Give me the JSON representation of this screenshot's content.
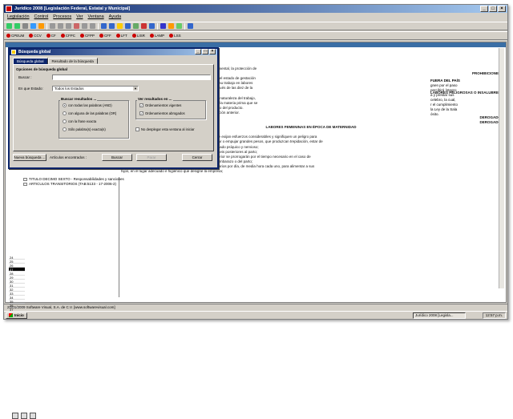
{
  "window": {
    "title": "Jurídico 2008 [Legislación Federal, Estatal y Municipal]",
    "btn_min": "_",
    "btn_max": "□",
    "btn_close": "×"
  },
  "menu": [
    "Legislación",
    "Control",
    "Procesos",
    "Ver",
    "Ventana",
    "Ayuda"
  ],
  "codes": [
    "CPEUM",
    "CCV",
    "CF",
    "CFPC",
    "CFPP",
    "CFF",
    "LFT",
    "LISR",
    "LAMP",
    "LSS"
  ],
  "dialog": {
    "title": "Búsqueda global",
    "tabs": [
      "Búsqueda global",
      "Resultado de la búsqueda"
    ],
    "options_title": "Opciones de búsqueda global",
    "buscar_label": "Buscar :",
    "buscar_value": "",
    "estado_label": "En que Estado:",
    "estado_value": "Todos los Estados",
    "buscar_resultados_title": "Buscar resultados ...",
    "radios": [
      "con todas las palabras (AND)",
      "con alguna de las palabras (OR)",
      "con la frase exacta",
      "Sólo palabra(s) exacta(s)"
    ],
    "ver_title": "Ver resultados en ...",
    "ver_checks": [
      "Ordenamientos vigentes",
      "Ordenamientos abrogados"
    ],
    "no_display": "No desplegar esta ventana al iniciar",
    "btn_nueva": "Nueva búsqueda ...",
    "found_label": "Artículos encontrados :",
    "btn_buscar": "Buscar",
    "btn_parar": "Parar",
    "btn_cerrar": "Cerrar"
  },
  "tree": [
    "TITULO DECIMO SEXTO - Responsabilidades y sanciones",
    "ARTICULOS TRANSITORIOS (TAB:5133 - 17-2006-2)"
  ],
  "numbers": [
    "24",
    "25",
    "26",
    "27",
    "28",
    "29",
    "30",
    "31",
    "32",
    "33",
    "34",
    "35",
    "36",
    "37"
  ],
  "doc_lines": [
    {
      "t": "e se consignan en este capítulo tienen como propósito fundamental, la protección de",
      "c": ""
    },
    {
      "t": "PROHIBICIONES",
      "c": "hr"
    },
    {
      "t": "peligro la salud de la mujer, o la del producto, ya sea durante el estado de gestación",
      "c": ""
    },
    {
      "t": "o en su salario, prestaciones y derechos, no se podrá utilizar su trabajo en labores",
      "c": ""
    },
    {
      "t": "industrial, en establecimientos comerciales o de servicio después de las diez de la",
      "c": ""
    },
    {
      "t": "",
      "c": ""
    },
    {
      "t": "LABORES PELIGROSAS O INSALUBRES",
      "c": "hr"
    },
    {
      "t": "este título, son labores peligrosas o insalubres las que, por la naturaleza del trabajo,",
      "c": ""
    },
    {
      "t": "ológicas del medio en que se presta, o por la composición de la materia prima que se",
      "c": ""
    },
    {
      "t": "y la salud física y mental de la mujer en estado de gestación, o del producto.",
      "c": ""
    },
    {
      "t": "erminarán los trabajos que quedan comprendidos en la definición anterior.",
      "c": ""
    },
    {
      "t": "",
      "c": ""
    },
    {
      "t": "DEROGADO",
      "c": "hr"
    },
    {
      "t": "",
      "c": ""
    },
    {
      "t": "DEROGADO",
      "c": "hr"
    },
    {
      "t": "",
      "c": ""
    },
    {
      "t": "LABORES FEMENINAS EN ÉPOCA DE MATERNIDAD",
      "c": "h"
    },
    {
      "t": "Las madres trabajadoras tendrán los siguientes derechos:",
      "c": ""
    },
    {
      "t": "I. Durante el período del embarazo, no realizarán trabajos que exijan esfuerzos considerables y signifiquen un peligro para",
      "c": ""
    },
    {
      "t": "su salud en relación con la gestación, tales como levantar, tirar o empujar grandes pesos, que produzcan trepidación, estar de",
      "c": ""
    },
    {
      "t": "pie durante largo tiempo o que actúen o puedan alterar su estado psíquico y nervioso;",
      "c": ""
    },
    {
      "t": "II. Disfrutarán de un descanso de seis semanas anteriores y seis posteriores al parto;",
      "c": ""
    },
    {
      "t": "III. Los períodos de descanso a que se refiere la fracción anterior se prorrogarán por el tiempo necesario en el caso de",
      "c": ""
    },
    {
      "t": "que se encuentren imposibilitadas para trabajar a causa del embarazo o del parto;",
      "c": ""
    },
    {
      "t": "IV. En el período de lactancia tendrán dos reposos extraordinarios por día, de media hora cada uno, para alimentar a sus",
      "c": ""
    },
    {
      "t": "hijos, en el lugar adecuado e higiénico que designe la empresa;",
      "c": ""
    }
  ],
  "right_col": [
    "FUERA DEL PAÍS",
    "",
    "",
    "",
    "",
    "gnen por el paso",
    "percibirá íntegro",
    "",
    "",
    "a y prestar sus",
    "",
    "",
    "",
    "celebro, la cual,",
    "r el cumplimiento",
    "la Ley de la Sala",
    "",
    "",
    "ósito."
  ],
  "status": "21/01/2009    Software Visual, S.A. de C.V. [www.softwarevisual.com]",
  "taskbar": {
    "start": "Inicio",
    "task": "Jurídico 2008 [Legisla...",
    "clock": "12:57 p.m."
  },
  "colors": {
    "titlebar": "#0a246a",
    "chrome": "#d4d0c8"
  }
}
